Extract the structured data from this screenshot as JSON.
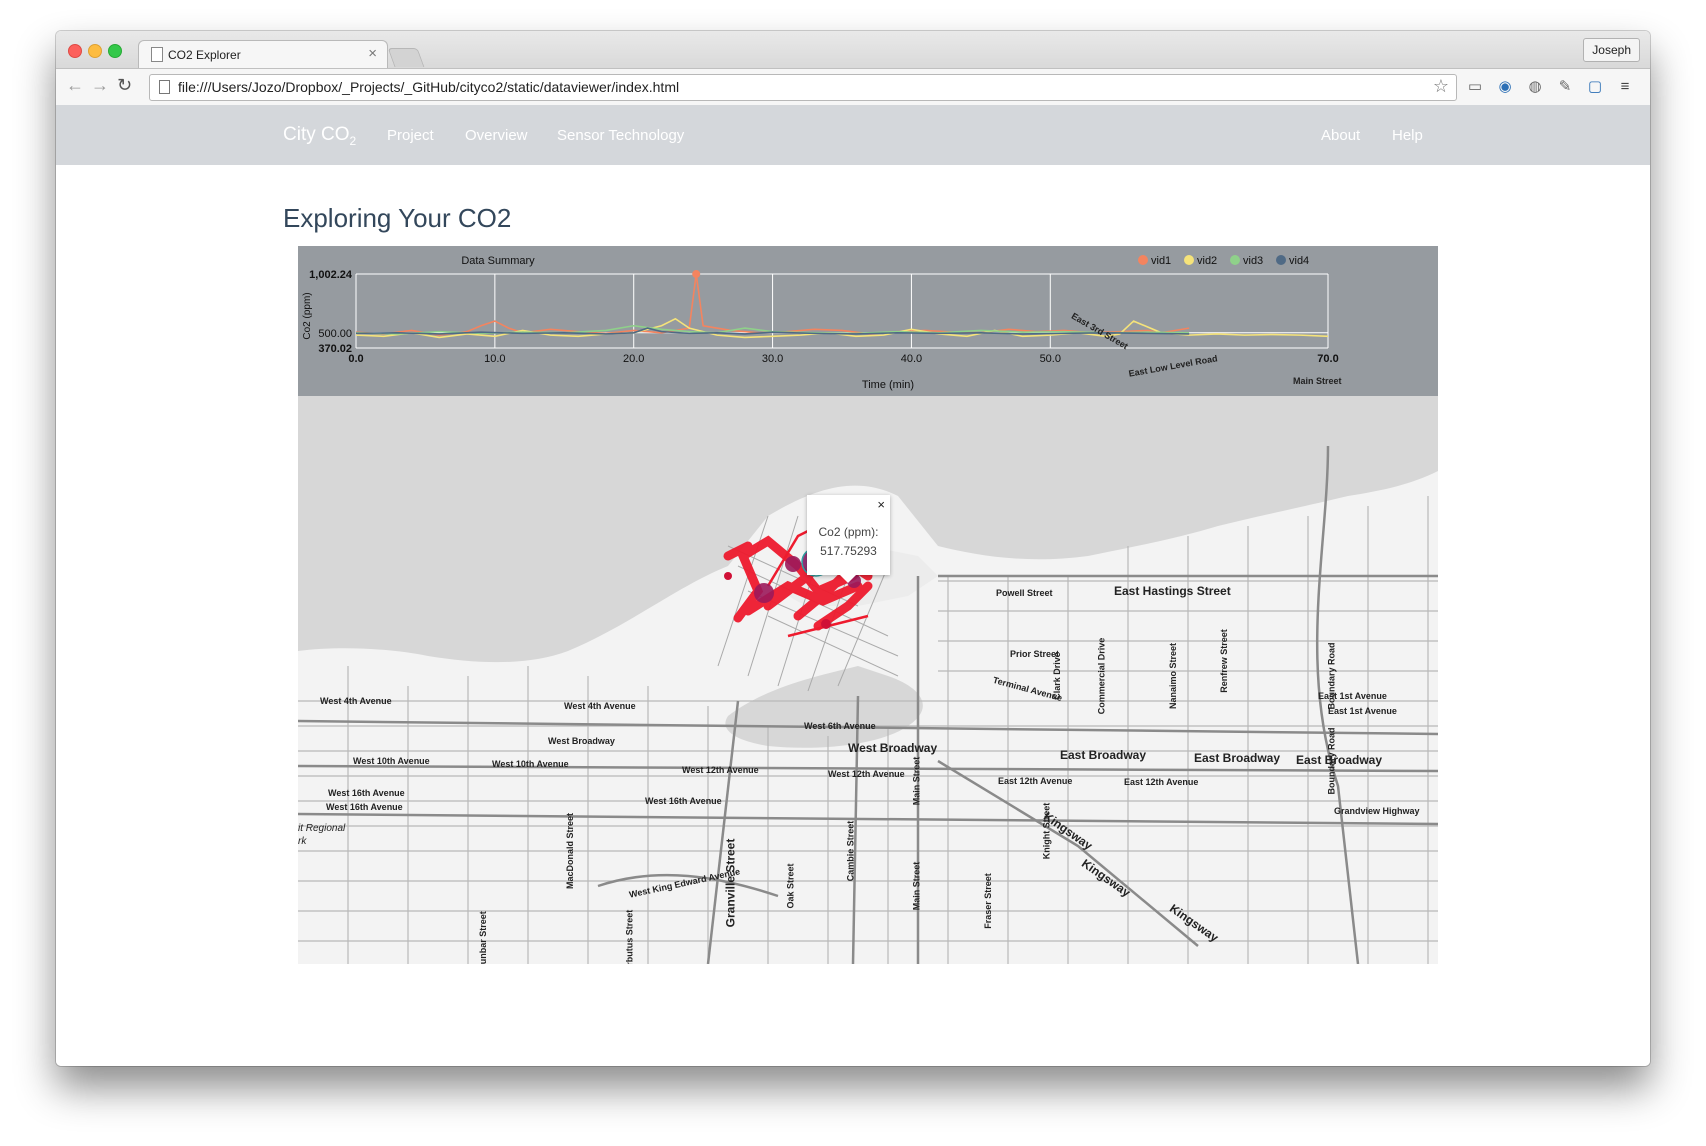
{
  "browser": {
    "tab_title": "CO2 Explorer",
    "tab_close": "×",
    "profile_name": "Joseph",
    "url": "file:///Users/Jozo/Dropbox/_Projects/_GitHub/cityco2/static/dataviewer/index.html",
    "icons": [
      "back-icon",
      "forward-icon",
      "reload-icon",
      "page-icon",
      "bookmark-star-icon",
      "extension-icon",
      "camera-icon",
      "download-icon",
      "eyedropper-icon",
      "fullscreen-icon",
      "menu-icon"
    ]
  },
  "navbar": {
    "brand_text": "City CO",
    "brand_sub": "2",
    "links": [
      "Project",
      "Overview",
      "Sensor Technology"
    ],
    "right_links": [
      "About",
      "Help"
    ]
  },
  "page": {
    "title": "Exploring Your CO2"
  },
  "chart_data": {
    "type": "line",
    "title": "Data Summary",
    "xlabel": "Time (min)",
    "ylabel": "Co2 (ppm)",
    "xlim": [
      0.0,
      70.0
    ],
    "ylim": [
      370.02,
      1002.24
    ],
    "x_ticks": [
      "0.0",
      "10.0",
      "20.0",
      "30.0",
      "40.0",
      "50.0",
      "70.0"
    ],
    "y_ticks": [
      "370.02",
      "500.00",
      "1,002.24"
    ],
    "legend_position": "top-right",
    "grid": true,
    "series": [
      {
        "name": "vid1",
        "color": "#f4845f",
        "x": [
          0,
          2,
          4,
          6,
          8,
          9,
          10,
          11,
          12,
          14,
          16,
          18,
          20,
          22,
          24,
          24.5,
          25,
          27,
          29,
          31,
          33,
          35,
          37,
          39,
          41,
          43,
          45,
          47,
          49,
          51,
          53,
          55,
          57,
          58,
          60
        ],
        "y": [
          505,
          490,
          520,
          480,
          510,
          560,
          600,
          540,
          500,
          530,
          510,
          495,
          520,
          500,
          540,
          1002,
          560,
          520,
          500,
          510,
          530,
          520,
          490,
          510,
          520,
          505,
          500,
          530,
          510,
          520,
          500,
          510,
          520,
          500,
          540
        ]
      },
      {
        "name": "vid2",
        "color": "#f5e37a",
        "x": [
          0,
          2,
          4,
          6,
          8,
          10,
          12,
          14,
          16,
          18,
          20,
          22,
          23,
          24,
          26,
          28,
          30,
          32,
          34,
          36,
          38,
          40,
          42,
          44,
          46,
          48,
          50,
          52,
          54,
          55,
          56,
          58,
          60,
          62,
          64,
          66,
          68,
          70
        ],
        "y": [
          480,
          470,
          500,
          460,
          490,
          470,
          520,
          480,
          470,
          490,
          500,
          560,
          620,
          540,
          480,
          460,
          470,
          480,
          500,
          470,
          480,
          530,
          490,
          470,
          520,
          470,
          480,
          500,
          470,
          490,
          600,
          500,
          480,
          490,
          480,
          485,
          480,
          470
        ]
      },
      {
        "name": "vid3",
        "color": "#8fd18a",
        "x": [
          0,
          3,
          6,
          9,
          12,
          15,
          18,
          20,
          22,
          24,
          26,
          28,
          30,
          33,
          36,
          39,
          42,
          45,
          48,
          51,
          54,
          57,
          60
        ],
        "y": [
          500,
          490,
          510,
          495,
          505,
          500,
          520,
          560,
          530,
          510,
          500,
          540,
          510,
          500,
          495,
          510,
          500,
          520,
          505,
          510,
          500,
          505,
          500
        ]
      },
      {
        "name": "vid4",
        "color": "#4f6a85",
        "x": [
          0,
          3,
          6,
          9,
          12,
          15,
          18,
          20,
          21,
          22,
          24,
          26,
          28,
          30,
          33,
          36,
          39,
          42,
          45,
          48,
          51,
          54,
          57,
          60
        ],
        "y": [
          495,
          500,
          490,
          505,
          495,
          500,
          490,
          500,
          540,
          510,
          495,
          500,
          490,
          505,
          495,
          490,
          500,
          495,
          500,
          490,
          495,
          500,
          495,
          490
        ]
      }
    ]
  },
  "popup": {
    "close": "×",
    "label": "Co2 (ppm):",
    "value": "517.75293"
  },
  "streets": {
    "powell": "Powell Street",
    "hastings": "East Hastings Street",
    "prior": "Prior Street",
    "terminal": "Terminal Avenue",
    "w4_a": "West 4th Avenue",
    "w4_b": "West 4th Avenue",
    "w6": "West 6th Avenue",
    "wbroad_s": "West Broadway",
    "wbroad_b": "West Broadway",
    "ebroad_1": "East Broadway",
    "ebroad_2": "East Broadway",
    "ebroad_3": "East Broadway",
    "w10_a": "West 10th Avenue",
    "w10_b": "West 10th Avenue",
    "w12_a": "West 12th Avenue",
    "w12_b": "West 12th Avenue",
    "e12_a": "East 12th Avenue",
    "e12_b": "East 12th Avenue",
    "w16_a": "West 16th Avenue",
    "w16_b": "West 16th Avenue",
    "w16_c": "West 16th Avenue",
    "e1_a": "East 1st Avenue",
    "e1_b": "East 1st Avenue",
    "grandview": "Grandview Highway",
    "kingsway_1": "Kingsway",
    "kingsway_2": "Kingsway",
    "kingsway_3": "Kingsway",
    "wking": "West King Edward Avenue",
    "granville": "Granville Street",
    "oak": "Oak Street",
    "cambie": "Cambie Street",
    "main_1": "Main Street",
    "main_2": "Main Street",
    "main_3": "Main Street",
    "fraser": "Fraser Street",
    "knight": "Knight Street",
    "clark": "Clark Drive",
    "commercial": "Commercial Drive",
    "nanaimo": "Nanaimo Street",
    "renfrew": "Renfrew Street",
    "boundary_1": "Boundary Road",
    "boundary_2": "Boundary Road",
    "macdonald": "MacDonald Street",
    "arbutus": "Arbutus Street",
    "dunbar": "Dunbar Street",
    "east3": "East 3rd Street",
    "eastlow": "East Low Level Road",
    "regional": "it Regional",
    "park": "rk"
  }
}
